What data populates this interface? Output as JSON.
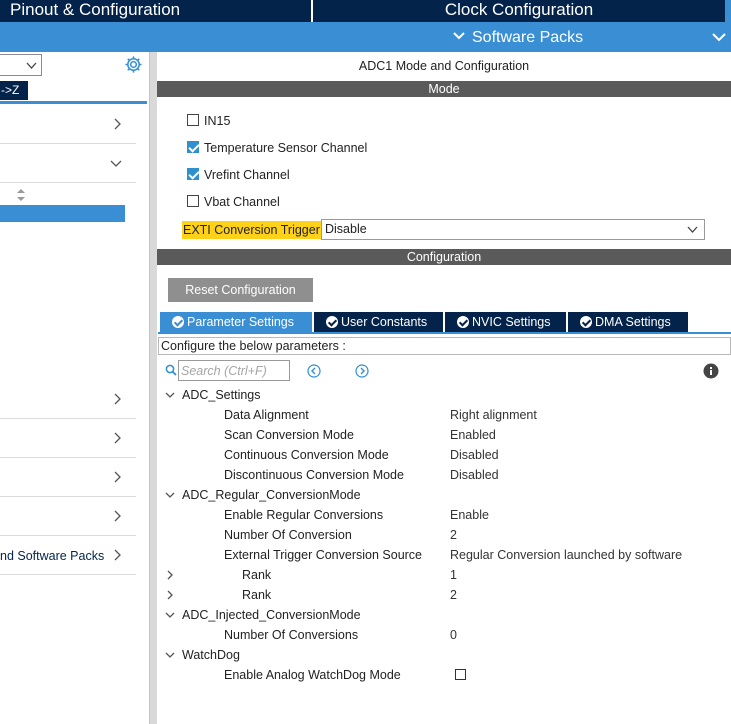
{
  "top_tabs": {
    "pinout": "Pinout & Configuration",
    "clock": "Clock Configuration",
    "software_packs": "Software Packs"
  },
  "left_panel": {
    "sort_button": "->Z",
    "software_packs_item": "nd Software Packs"
  },
  "mode": {
    "title": "ADC1 Mode and Configuration",
    "header": "Mode",
    "checkboxes": [
      {
        "label": "IN15",
        "checked": false
      },
      {
        "label": "Temperature Sensor Channel",
        "checked": true
      },
      {
        "label": "Vrefint Channel",
        "checked": true
      },
      {
        "label": "Vbat Channel",
        "checked": false
      }
    ],
    "exti_label": "EXTI Conversion Trigger",
    "exti_value": "Disable"
  },
  "configuration": {
    "header": "Configuration",
    "reset_button": "Reset Configuration",
    "tabs": [
      "Parameter Settings",
      "User Constants",
      "NVIC Settings",
      "DMA Settings"
    ],
    "active_tab": "Parameter Settings",
    "hint": "Configure the below parameters :",
    "search_placeholder": "Search (Ctrl+F)"
  },
  "parameters": {
    "adc_settings": {
      "name": "ADC_Settings",
      "rows": [
        {
          "name": "Data Alignment",
          "value": "Right alignment"
        },
        {
          "name": "Scan Conversion Mode",
          "value": "Enabled"
        },
        {
          "name": "Continuous Conversion Mode",
          "value": "Disabled"
        },
        {
          "name": "Discontinuous Conversion Mode",
          "value": "Disabled"
        }
      ]
    },
    "regular": {
      "name": "ADC_Regular_ConversionMode",
      "rows": [
        {
          "name": "Enable Regular Conversions",
          "value": "Enable"
        },
        {
          "name": "Number Of Conversion",
          "value": "2"
        },
        {
          "name": "External Trigger Conversion Source",
          "value": "Regular Conversion launched by software"
        }
      ],
      "ranks": [
        {
          "name": "Rank",
          "value": "1"
        },
        {
          "name": "Rank",
          "value": "2"
        }
      ]
    },
    "injected": {
      "name": "ADC_Injected_ConversionMode",
      "rows": [
        {
          "name": "Number Of Conversions",
          "value": "0"
        }
      ]
    },
    "watchdog": {
      "name": "WatchDog",
      "rows": [
        {
          "name": "Enable Analog WatchDog Mode",
          "checked": false
        }
      ]
    }
  },
  "colors": {
    "navy": "#03234b",
    "accent_blue": "#3a8fd4",
    "section_gray": "#5a5a5a",
    "highlight_yellow": "#ffd21a"
  }
}
